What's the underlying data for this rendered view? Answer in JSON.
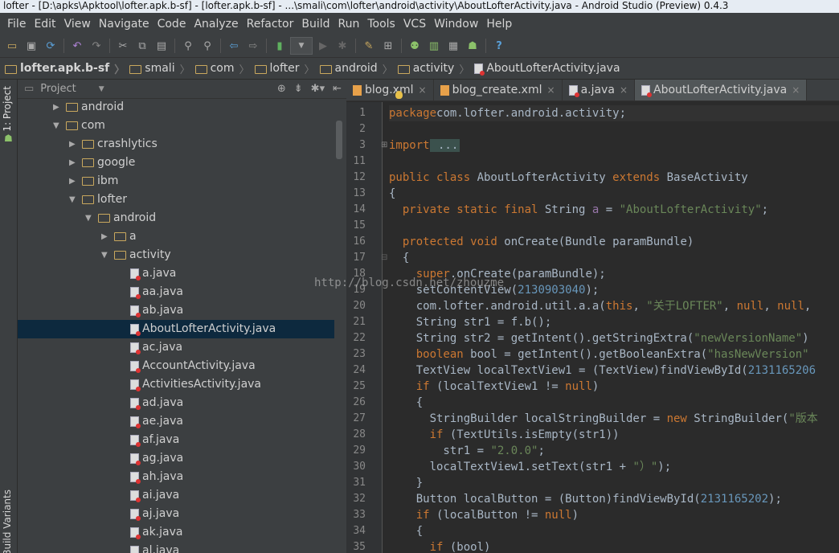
{
  "window": {
    "title": "lofter - [D:\\apks\\Apktool\\lofter.apk.b-sf] - [lofter.apk.b-sf] - ...\\smali\\com\\lofter\\android\\activity\\AboutLofterActivity.java - Android Studio (Preview) 0.4.3"
  },
  "menu": [
    "File",
    "Edit",
    "View",
    "Navigate",
    "Code",
    "Analyze",
    "Refactor",
    "Build",
    "Run",
    "Tools",
    "VCS",
    "Window",
    "Help"
  ],
  "breadcrumb": [
    "lofter.apk.b-sf",
    "smali",
    "com",
    "lofter",
    "android",
    "activity",
    "AboutLofterActivity.java"
  ],
  "side_tabs": {
    "project": "1: Project",
    "build_variants": "Build Variants"
  },
  "project_panel": {
    "title": "Project"
  },
  "tree": [
    {
      "label": "android",
      "level": 2,
      "type": "folder",
      "expanded": false
    },
    {
      "label": "com",
      "level": 2,
      "type": "folder",
      "expanded": true
    },
    {
      "label": "crashlytics",
      "level": 3,
      "type": "folder",
      "expanded": false
    },
    {
      "label": "google",
      "level": 3,
      "type": "folder",
      "expanded": false
    },
    {
      "label": "ibm",
      "level": 3,
      "type": "folder",
      "expanded": false
    },
    {
      "label": "lofter",
      "level": 3,
      "type": "folder",
      "expanded": true
    },
    {
      "label": "android",
      "level": 4,
      "type": "folder",
      "expanded": true
    },
    {
      "label": "a",
      "level": 5,
      "type": "folder",
      "expanded": false
    },
    {
      "label": "activity",
      "level": 5,
      "type": "folder",
      "expanded": true
    },
    {
      "label": "a.java",
      "level": 6,
      "type": "file"
    },
    {
      "label": "aa.java",
      "level": 6,
      "type": "file"
    },
    {
      "label": "ab.java",
      "level": 6,
      "type": "file"
    },
    {
      "label": "AboutLofterActivity.java",
      "level": 6,
      "type": "file",
      "selected": true
    },
    {
      "label": "ac.java",
      "level": 6,
      "type": "file"
    },
    {
      "label": "AccountActivity.java",
      "level": 6,
      "type": "file"
    },
    {
      "label": "ActivitiesActivity.java",
      "level": 6,
      "type": "file"
    },
    {
      "label": "ad.java",
      "level": 6,
      "type": "file"
    },
    {
      "label": "ae.java",
      "level": 6,
      "type": "file"
    },
    {
      "label": "af.java",
      "level": 6,
      "type": "file"
    },
    {
      "label": "ag.java",
      "level": 6,
      "type": "file"
    },
    {
      "label": "ah.java",
      "level": 6,
      "type": "file"
    },
    {
      "label": "ai.java",
      "level": 6,
      "type": "file"
    },
    {
      "label": "aj.java",
      "level": 6,
      "type": "file"
    },
    {
      "label": "ak.java",
      "level": 6,
      "type": "file"
    },
    {
      "label": "al.java",
      "level": 6,
      "type": "file"
    }
  ],
  "tabs": [
    {
      "label": "blog.xml",
      "kind": "xml",
      "active": false
    },
    {
      "label": "blog_create.xml",
      "kind": "xml",
      "active": false
    },
    {
      "label": "a.java",
      "kind": "java",
      "active": false
    },
    {
      "label": "AboutLofterActivity.java",
      "kind": "java",
      "active": true
    }
  ],
  "line_numbers": [
    "1",
    "2",
    "3",
    "11",
    "12",
    "13",
    "14",
    "15",
    "16",
    "17",
    "18",
    "19",
    "20",
    "21",
    "22",
    "23",
    "24",
    "25",
    "26",
    "27",
    "28",
    "29",
    "30",
    "31",
    "32",
    "33",
    "34",
    "35"
  ],
  "code": [
    [
      [
        "kw",
        "package"
      ],
      [
        "",
        "com.lofter.android.activity;"
      ]
    ],
    [],
    [
      [
        "kw",
        "import"
      ],
      [
        "",
        ""
      ],
      [
        "fold",
        " ..."
      ]
    ],
    [],
    [
      [
        "kw",
        "public class "
      ],
      [
        "",
        "AboutLofterActivity "
      ],
      [
        "kw",
        "extends "
      ],
      [
        "",
        "BaseActivity"
      ]
    ],
    [
      [
        "",
        "{"
      ]
    ],
    [
      [
        "",
        "  "
      ],
      [
        "kw",
        "private static final "
      ],
      [
        "",
        "String "
      ],
      [
        "fd",
        "a"
      ],
      [
        "",
        " = "
      ],
      [
        "st",
        "\"AboutLofterActivity\""
      ],
      [
        "",
        ";"
      ]
    ],
    [],
    [
      [
        "",
        "  "
      ],
      [
        "kw",
        "protected void "
      ],
      [
        "",
        "onCreate(Bundle paramBundle)"
      ]
    ],
    [
      [
        "",
        "  {"
      ]
    ],
    [
      [
        "",
        "    "
      ],
      [
        "kw",
        "super"
      ],
      [
        "",
        ".onCreate(paramBundle);"
      ]
    ],
    [
      [
        "",
        "    setContentView("
      ],
      [
        "nm",
        "2130903040"
      ],
      [
        "",
        ");"
      ]
    ],
    [
      [
        "",
        "    com.lofter.android.util.a.a("
      ],
      [
        "kw",
        "this"
      ],
      [
        "",
        ", "
      ],
      [
        "st",
        "\"关于LOFTER\""
      ],
      [
        "",
        ", "
      ],
      [
        "kw",
        "null"
      ],
      [
        "",
        ", "
      ],
      [
        "kw",
        "null"
      ],
      [
        "",
        ","
      ]
    ],
    [
      [
        "",
        "    String str1 = f.b();"
      ]
    ],
    [
      [
        "",
        "    String str2 = getIntent().getStringExtra("
      ],
      [
        "st",
        "\"newVersionName\""
      ],
      [
        "",
        ")"
      ]
    ],
    [
      [
        "",
        "    "
      ],
      [
        "kw",
        "boolean "
      ],
      [
        "",
        "bool = getIntent().getBooleanExtra("
      ],
      [
        "st",
        "\"hasNewVersion\""
      ]
    ],
    [
      [
        "",
        "    TextView localTextView1 = (TextView)findViewById("
      ],
      [
        "nm",
        "2131165206"
      ]
    ],
    [
      [
        "",
        "    "
      ],
      [
        "kw",
        "if "
      ],
      [
        "",
        "(localTextView1 != "
      ],
      [
        "kw",
        "null"
      ],
      [
        "",
        ")"
      ]
    ],
    [
      [
        "",
        "    {"
      ]
    ],
    [
      [
        "",
        "      StringBuilder localStringBuilder = "
      ],
      [
        "kw",
        "new "
      ],
      [
        "",
        "StringBuilder("
      ],
      [
        "st",
        "\"版本"
      ]
    ],
    [
      [
        "",
        "      "
      ],
      [
        "kw",
        "if "
      ],
      [
        "",
        "(TextUtils.isEmpty(str1))"
      ]
    ],
    [
      [
        "",
        "        str1 = "
      ],
      [
        "st",
        "\"2.0.0\""
      ],
      [
        "",
        ";"
      ]
    ],
    [
      [
        "",
        "      localTextView1.setText(str1 + "
      ],
      [
        "st",
        "\"）\""
      ],
      [
        "",
        ");"
      ]
    ],
    [
      [
        "",
        "    }"
      ]
    ],
    [
      [
        "",
        "    Button localButton = (Button)findViewById("
      ],
      [
        "nm",
        "2131165202"
      ],
      [
        "",
        ");"
      ]
    ],
    [
      [
        "",
        "    "
      ],
      [
        "kw",
        "if "
      ],
      [
        "",
        "(localButton != "
      ],
      [
        "kw",
        "null"
      ],
      [
        "",
        ")"
      ]
    ],
    [
      [
        "",
        "    {"
      ]
    ],
    [
      [
        "",
        "      "
      ],
      [
        "kw",
        "if "
      ],
      [
        "",
        "(bool)"
      ]
    ]
  ],
  "watermark": "http://blog.csdn.net/zhouzme",
  "colors": {
    "keyword": "#cc7832",
    "string": "#6a8759",
    "number": "#6897bb",
    "field": "#9876aa",
    "text": "#a9b7c6",
    "selection": "#0d293e"
  }
}
